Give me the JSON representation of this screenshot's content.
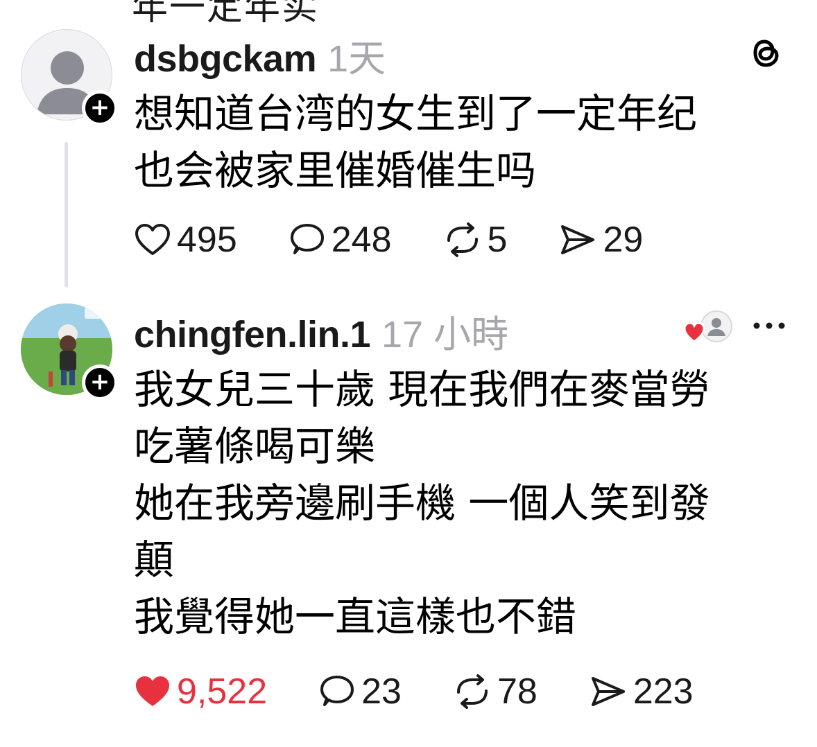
{
  "top_cutoff_text": "年一定年实",
  "posts": [
    {
      "username": "dsbgckam",
      "time": "1天",
      "lines": [
        "想知道台湾的女生到了一定年纪",
        "也会被家里催婚催生吗"
      ],
      "likes": "495",
      "replies": "248",
      "reposts": "5",
      "shares": "29",
      "liked": false,
      "avatar": "default-avatar-icon"
    },
    {
      "username": "chingfen.lin.1",
      "time": "17 小時",
      "lines": [
        "我女兒三十歲 現在我們在麥當勞",
        "吃薯條喝可樂",
        "她在我旁邊刷手機 一個人笑到發",
        "顛",
        "我覺得她一直這樣也不錯"
      ],
      "likes": "9,522",
      "replies": "23",
      "reposts": "78",
      "shares": "223",
      "liked": true,
      "avatar": "profile-photo"
    }
  ],
  "colors": {
    "liked_red": "#e8313f",
    "secondary_text": "#a6a6ad",
    "primary_text": "#1a1a1a",
    "thread_line": "#e2e2e6"
  },
  "icons": {
    "like": "heart-icon",
    "reply": "speech-bubble-icon",
    "repost": "repost-icon",
    "share": "paper-plane-icon",
    "app": "threads-logo-icon",
    "more": "more-dots-icon"
  }
}
